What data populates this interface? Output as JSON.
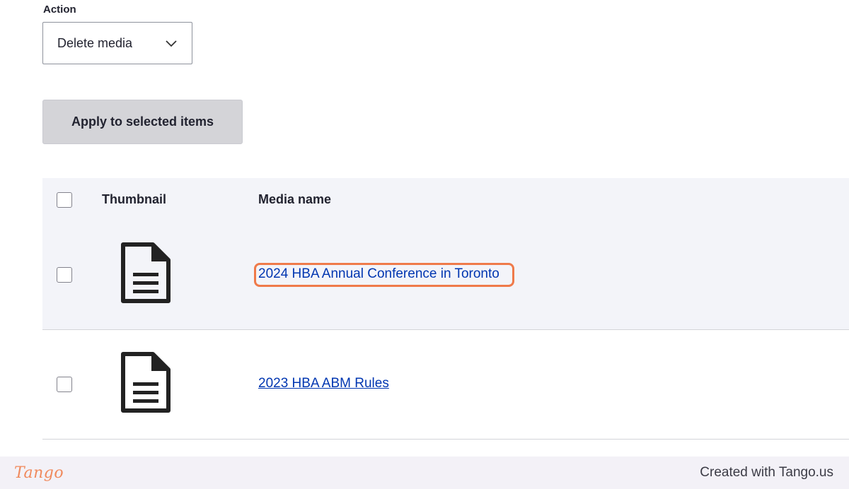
{
  "action": {
    "label": "Action",
    "selected": "Delete media"
  },
  "apply_button": "Apply to selected items",
  "table": {
    "headers": {
      "thumbnail": "Thumbnail",
      "media_name": "Media name"
    },
    "rows": [
      {
        "name": "2024 HBA Annual Conference in Toronto",
        "thumbnail_icon": "document-icon",
        "checked": false,
        "highlighted": true
      },
      {
        "name": "2023 HBA ABM Rules",
        "thumbnail_icon": "document-icon",
        "checked": false,
        "highlighted": false
      }
    ]
  },
  "footer": {
    "logo": "Tango",
    "text": "Created with Tango.us"
  },
  "colors": {
    "link": "#0036b1",
    "highlight_ring": "#ef7a4a",
    "button_bg": "#d4d4d8",
    "header_bg": "#f3f4f9"
  }
}
